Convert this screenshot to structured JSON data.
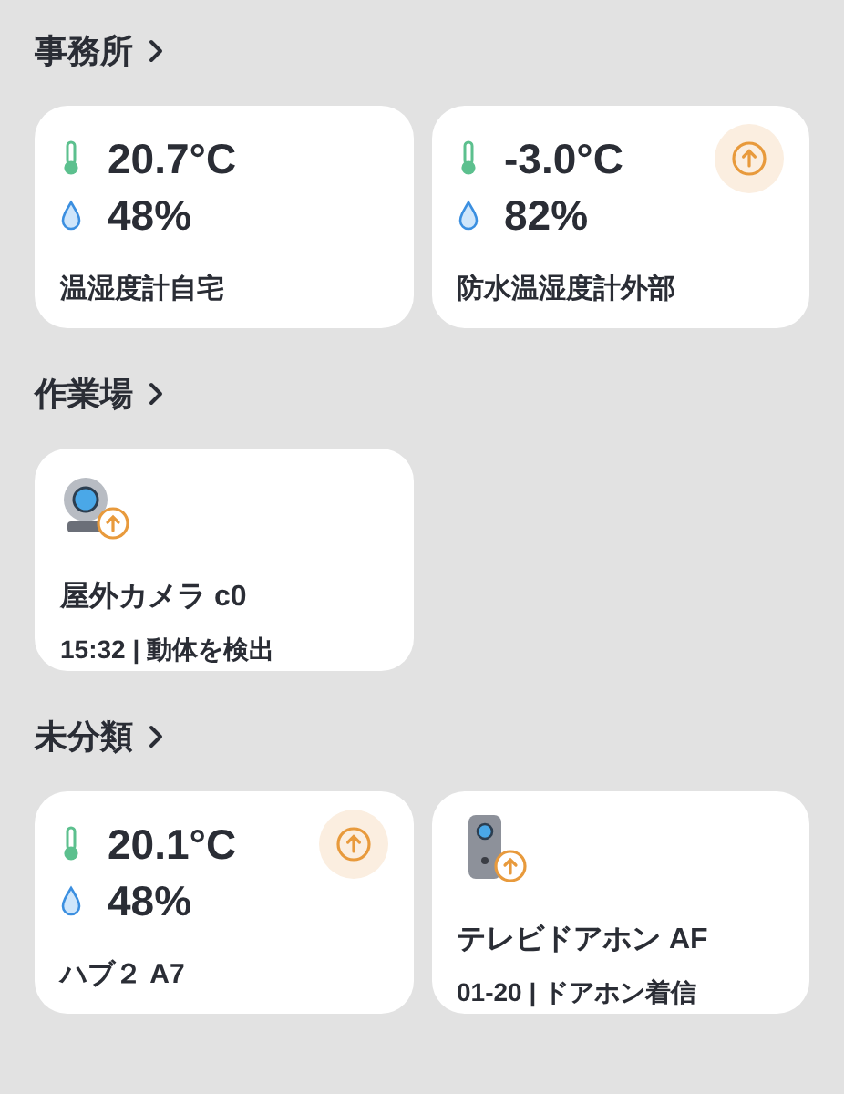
{
  "sections": [
    {
      "title": "事務所",
      "cards": [
        {
          "kind": "sensor",
          "temperature": "20.7°C",
          "humidity": "48%",
          "name": "温湿度計自宅",
          "update": false
        },
        {
          "kind": "sensor",
          "temperature": "-3.0°C",
          "humidity": "82%",
          "name": "防水温湿度計外部",
          "update": true
        }
      ]
    },
    {
      "title": "作業場",
      "cards": [
        {
          "kind": "camera",
          "name": "屋外カメラ c0",
          "status": "15:32 | 動体を検出",
          "update": true
        }
      ]
    },
    {
      "title": "未分類",
      "cards": [
        {
          "kind": "sensor",
          "temperature": "20.1°C",
          "humidity": "48%",
          "name": "ハブ２ A7",
          "update": true
        },
        {
          "kind": "doorbell",
          "name": "テレビドアホン AF",
          "status": "01-20 | ドアホン着信",
          "update": true
        }
      ]
    }
  ]
}
